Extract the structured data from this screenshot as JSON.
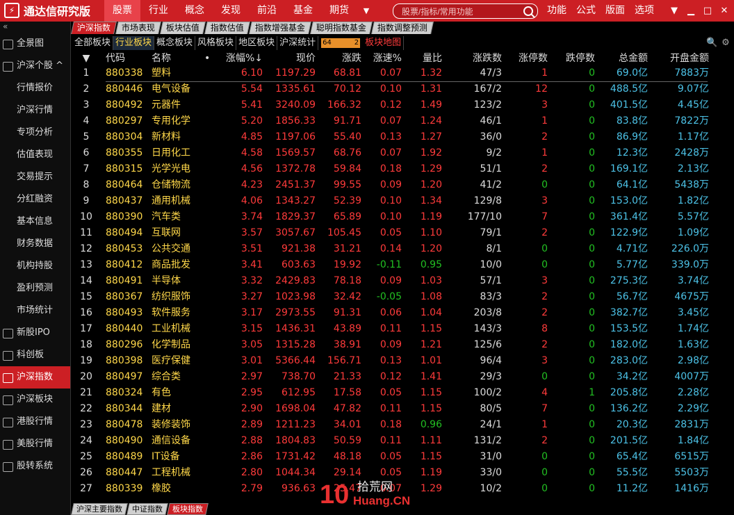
{
  "app": {
    "title": "通达信研究版"
  },
  "topmenu": [
    "股票",
    "行业",
    "概念",
    "发现",
    "前沿",
    "基金",
    "期货"
  ],
  "search": {
    "placeholder": "股票/指标/常用功能"
  },
  "rightmenu": [
    "功能",
    "公式",
    "版面",
    "选项"
  ],
  "sidebar": {
    "collapse": "«",
    "items": [
      {
        "label": "全景图",
        "type": "top"
      },
      {
        "label": "沪深个股 ^",
        "type": "top"
      },
      {
        "label": "行情报价",
        "type": "sub"
      },
      {
        "label": "沪深行情",
        "type": "sub"
      },
      {
        "label": "专项分析",
        "type": "sub"
      },
      {
        "label": "估值表现",
        "type": "sub"
      },
      {
        "label": "交易提示",
        "type": "sub"
      },
      {
        "label": "分红融资",
        "type": "sub"
      },
      {
        "label": "基本信息",
        "type": "sub"
      },
      {
        "label": "财务数据",
        "type": "sub"
      },
      {
        "label": "机构持股",
        "type": "sub"
      },
      {
        "label": "盈利预测",
        "type": "sub"
      },
      {
        "label": "市场统计",
        "type": "sub"
      },
      {
        "label": "新股IPO",
        "type": "top"
      },
      {
        "label": "科创板",
        "type": "top"
      },
      {
        "label": "沪深指数",
        "type": "top",
        "active": true
      },
      {
        "label": "沪深板块",
        "type": "top"
      },
      {
        "label": "港股行情",
        "type": "top"
      },
      {
        "label": "美股行情",
        "type": "top"
      },
      {
        "label": "股转系统",
        "type": "top"
      }
    ]
  },
  "tabs1": [
    "沪深指数",
    "市场表现",
    "板块估值",
    "指数估值",
    "指数增强基金",
    "聪明指数基金",
    "指数调整预测"
  ],
  "tabs2": [
    "全部板块",
    "行业板块",
    "概念板块",
    "风格板块",
    "地区板块",
    "沪深统计"
  ],
  "badge": {
    "left": "64",
    "right": "2"
  },
  "map_label": "板块地图",
  "columns": [
    "代码",
    "名称",
    "•",
    "涨幅%↓",
    "现价",
    "涨跌",
    "涨速%",
    "量比",
    "涨跌数",
    "涨停数",
    "跌停数",
    "总金额",
    "开盘金额"
  ],
  "rows": [
    [
      "1",
      "880338",
      "塑料",
      "6.10",
      "1197.29",
      "68.81",
      "0.07",
      "1.32",
      "47/3",
      "1",
      "0",
      "69.0亿",
      "7883万"
    ],
    [
      "2",
      "880446",
      "电气设备",
      "5.54",
      "1335.61",
      "70.12",
      "0.10",
      "1.31",
      "167/2",
      "12",
      "0",
      "488.5亿",
      "9.07亿"
    ],
    [
      "3",
      "880492",
      "元器件",
      "5.41",
      "3240.09",
      "166.32",
      "0.12",
      "1.49",
      "123/2",
      "3",
      "0",
      "401.5亿",
      "4.45亿"
    ],
    [
      "4",
      "880297",
      "专用化学",
      "5.20",
      "1856.33",
      "91.71",
      "0.07",
      "1.24",
      "46/1",
      "1",
      "0",
      "83.8亿",
      "7822万"
    ],
    [
      "5",
      "880304",
      "新材料",
      "4.85",
      "1197.06",
      "55.40",
      "0.13",
      "1.27",
      "36/0",
      "2",
      "0",
      "86.9亿",
      "1.17亿"
    ],
    [
      "6",
      "880355",
      "日用化工",
      "4.58",
      "1569.57",
      "68.76",
      "0.07",
      "1.92",
      "9/2",
      "1",
      "0",
      "12.3亿",
      "2428万"
    ],
    [
      "7",
      "880315",
      "光学光电",
      "4.56",
      "1372.78",
      "59.84",
      "0.18",
      "1.29",
      "51/1",
      "2",
      "0",
      "169.1亿",
      "2.13亿"
    ],
    [
      "8",
      "880464",
      "仓储物流",
      "4.23",
      "2451.37",
      "99.55",
      "0.09",
      "1.20",
      "41/2",
      "0",
      "0",
      "64.1亿",
      "5438万"
    ],
    [
      "9",
      "880437",
      "通用机械",
      "4.06",
      "1343.27",
      "52.39",
      "0.10",
      "1.34",
      "129/8",
      "3",
      "0",
      "153.0亿",
      "1.82亿"
    ],
    [
      "10",
      "880390",
      "汽车类",
      "3.74",
      "1829.37",
      "65.89",
      "0.10",
      "1.19",
      "177/10",
      "7",
      "0",
      "361.4亿",
      "5.57亿"
    ],
    [
      "11",
      "880494",
      "互联网",
      "3.57",
      "3057.67",
      "105.45",
      "0.05",
      "1.10",
      "79/1",
      "2",
      "0",
      "122.9亿",
      "1.09亿"
    ],
    [
      "12",
      "880453",
      "公共交通",
      "3.51",
      "921.38",
      "31.21",
      "0.14",
      "1.20",
      "8/1",
      "0",
      "0",
      "4.71亿",
      "226.0万"
    ],
    [
      "13",
      "880412",
      "商品批发",
      "3.41",
      "603.63",
      "19.92",
      "-0.11",
      "0.95",
      "10/0",
      "0",
      "0",
      "5.77亿",
      "339.0万"
    ],
    [
      "14",
      "880491",
      "半导体",
      "3.32",
      "2429.83",
      "78.18",
      "0.09",
      "1.03",
      "57/1",
      "3",
      "0",
      "275.3亿",
      "3.74亿"
    ],
    [
      "15",
      "880367",
      "纺织服饰",
      "3.27",
      "1023.98",
      "32.42",
      "-0.05",
      "1.08",
      "83/3",
      "2",
      "0",
      "56.7亿",
      "4675万"
    ],
    [
      "16",
      "880493",
      "软件服务",
      "3.17",
      "2973.55",
      "91.31",
      "0.06",
      "1.04",
      "203/8",
      "2",
      "0",
      "382.7亿",
      "3.45亿"
    ],
    [
      "17",
      "880440",
      "工业机械",
      "3.15",
      "1436.31",
      "43.89",
      "0.11",
      "1.15",
      "143/3",
      "8",
      "0",
      "153.5亿",
      "1.74亿"
    ],
    [
      "18",
      "880296",
      "化学制品",
      "3.05",
      "1315.28",
      "38.91",
      "0.09",
      "1.21",
      "125/6",
      "2",
      "0",
      "182.0亿",
      "1.63亿"
    ],
    [
      "19",
      "880398",
      "医疗保健",
      "3.01",
      "5366.44",
      "156.71",
      "0.13",
      "1.01",
      "96/4",
      "3",
      "0",
      "283.0亿",
      "2.98亿"
    ],
    [
      "20",
      "880497",
      "综合类",
      "2.97",
      "738.70",
      "21.33",
      "0.12",
      "1.41",
      "29/3",
      "0",
      "0",
      "34.2亿",
      "4007万"
    ],
    [
      "21",
      "880324",
      "有色",
      "2.95",
      "612.95",
      "17.58",
      "0.05",
      "1.15",
      "100/2",
      "4",
      "1",
      "205.8亿",
      "2.28亿"
    ],
    [
      "22",
      "880344",
      "建材",
      "2.90",
      "1698.04",
      "47.82",
      "0.11",
      "1.15",
      "80/5",
      "7",
      "0",
      "136.2亿",
      "2.29亿"
    ],
    [
      "23",
      "880478",
      "装修装饰",
      "2.89",
      "1211.23",
      "34.01",
      "0.18",
      "0.96",
      "24/1",
      "1",
      "0",
      "20.3亿",
      "2831万"
    ],
    [
      "24",
      "880490",
      "通信设备",
      "2.88",
      "1804.83",
      "50.59",
      "0.11",
      "1.11",
      "131/2",
      "2",
      "0",
      "201.5亿",
      "1.84亿"
    ],
    [
      "25",
      "880489",
      "IT设备",
      "2.86",
      "1731.42",
      "48.18",
      "0.05",
      "1.15",
      "31/0",
      "0",
      "0",
      "65.4亿",
      "6515万"
    ],
    [
      "26",
      "880447",
      "工程机械",
      "2.80",
      "1044.34",
      "29.14",
      "0.05",
      "1.19",
      "33/0",
      "0",
      "0",
      "55.5亿",
      "5503万"
    ],
    [
      "27",
      "880339",
      "橡胶",
      "2.79",
      "936.63",
      "25.47",
      "0.07",
      "1.29",
      "10/2",
      "0",
      "0",
      "11.2亿",
      "1416万"
    ]
  ],
  "bottomtabs": [
    "沪深主要指数",
    "中证指数",
    "板块指数"
  ],
  "watermark": {
    "num": "10",
    "cn": "拾荒网",
    "en": "Huang.CN"
  }
}
